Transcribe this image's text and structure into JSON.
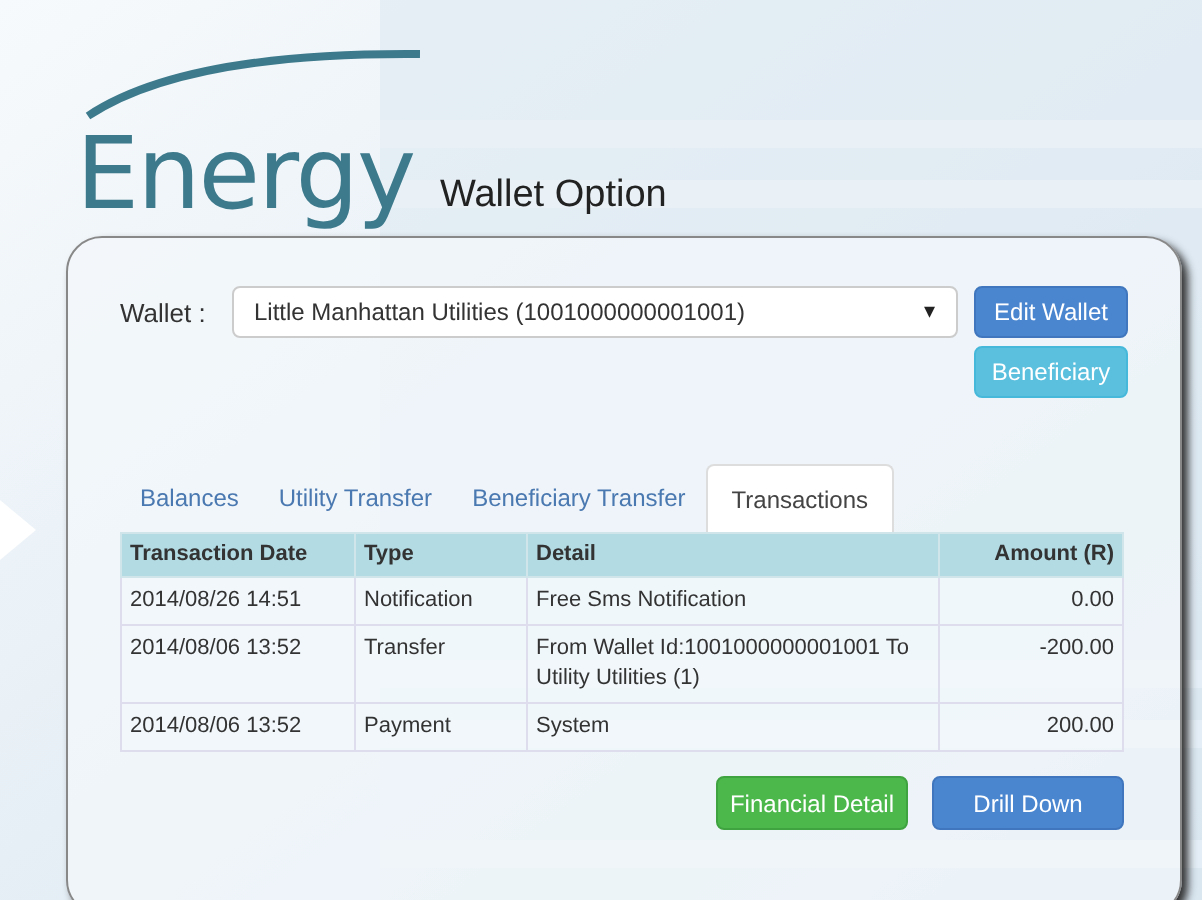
{
  "logo": "Energy",
  "page_title": "Wallet Option",
  "wallet": {
    "label": "Wallet :",
    "value": "Little Manhattan Utilities (1001000000001001)",
    "caret": "▾"
  },
  "side_buttons": [
    {
      "label": "Edit Wallet",
      "kind": "primary"
    },
    {
      "label": "Beneficiary",
      "kind": "info"
    }
  ],
  "tabs": [
    {
      "label": "Balances",
      "selected": false
    },
    {
      "label": "Utility Transfer",
      "selected": false
    },
    {
      "label": "Beneficiary Transfer",
      "selected": false
    },
    {
      "label": "Transactions",
      "selected": true
    }
  ],
  "table": {
    "columns": [
      "Transaction Date",
      "Type",
      "Detail",
      "Amount (R)"
    ],
    "rows": [
      [
        "2014/08/26 14:51",
        "Notification",
        "Free Sms Notification",
        "0.00"
      ],
      [
        "2014/08/06 13:52",
        "Transfer",
        "From Wallet Id:1001000000001001 To Utility Utilities (1)",
        "-200.00"
      ],
      [
        "2014/08/06 13:52",
        "Payment",
        "System",
        "200.00"
      ]
    ]
  },
  "actions": [
    {
      "label": "Financial Detail",
      "kind": "success"
    },
    {
      "label": "Drill Down",
      "kind": "primary"
    }
  ]
}
